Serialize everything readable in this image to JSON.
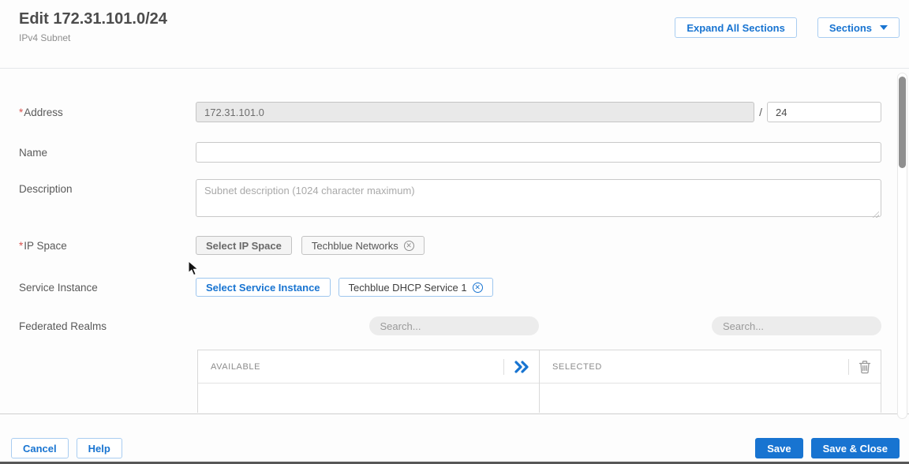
{
  "colors": {
    "accent_blue": "#1874d1",
    "required_red": "#d9534f",
    "disabled_gray": "#e9e9e9"
  },
  "header": {
    "title": "Edit 172.31.101.0/24",
    "subtitle": "IPv4 Subnet",
    "buttons": {
      "expand_all": "Expand All Sections",
      "sections": "Sections"
    }
  },
  "form": {
    "address": {
      "label": "Address",
      "required_mark": "*",
      "value": "172.31.101.0",
      "separator": "/",
      "cidr_value": "24"
    },
    "name": {
      "label": "Name",
      "value": ""
    },
    "description": {
      "label": "Description",
      "placeholder": "Subnet description (1024 character maximum)"
    },
    "ip_space": {
      "label": "IP Space",
      "required_mark": "*",
      "select_button": "Select IP Space",
      "selected_tag": "Techblue Networks"
    },
    "service_instance": {
      "label": "Service Instance",
      "select_button": "Select Service Instance",
      "selected_tag": "Techblue DHCP Service 1"
    },
    "federated_realms": {
      "label": "Federated Realms",
      "available_search_placeholder": "Search...",
      "selected_search_placeholder": "Search...",
      "columns": {
        "available": "AVAILABLE",
        "selected": "SELECTED"
      }
    }
  },
  "icons": {
    "sections_caret": "chevron-down",
    "remove_tag": "circle-x",
    "move_selected": "double-chevron-right",
    "clear_selected": "trash"
  },
  "footer": {
    "cancel": "Cancel",
    "help": "Help",
    "save": "Save",
    "save_close": "Save & Close"
  }
}
